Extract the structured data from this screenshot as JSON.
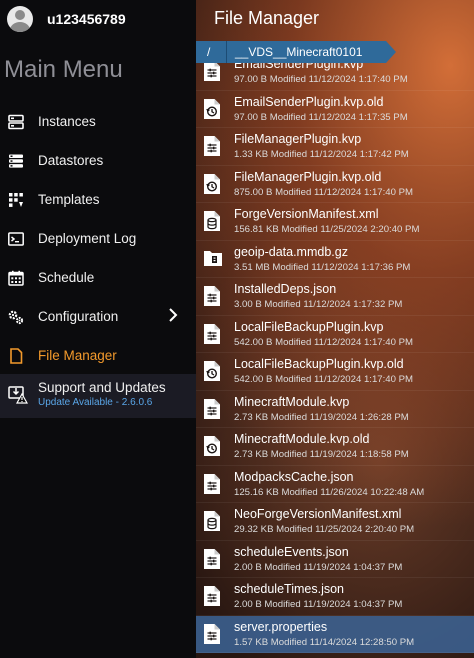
{
  "user": {
    "name": "u123456789"
  },
  "sidebar": {
    "title": "Main Menu",
    "items": [
      {
        "label": "Instances",
        "icon": "server-icon"
      },
      {
        "label": "Datastores",
        "icon": "database-icon"
      },
      {
        "label": "Templates",
        "icon": "templates-icon"
      },
      {
        "label": "Deployment Log",
        "icon": "terminal-icon"
      },
      {
        "label": "Schedule",
        "icon": "calendar-icon"
      },
      {
        "label": "Configuration",
        "icon": "gears-icon"
      },
      {
        "label": "File Manager",
        "icon": "file-icon",
        "active": true
      }
    ],
    "support": {
      "label": "Support and Updates",
      "update": "Update Available - 2.6.0.6"
    }
  },
  "main": {
    "title": "File Manager",
    "breadcrumb": {
      "root": "/",
      "folder": "__VDS__Minecraft0101"
    },
    "files": [
      {
        "name": "EmailSenderPlugin.kvp",
        "meta": "97.00 B Modified 11/12/2024 1:17:40 PM",
        "icon": "text-file-icon"
      },
      {
        "name": "EmailSenderPlugin.kvp.old",
        "meta": "97.00 B Modified 11/12/2024 1:17:35 PM",
        "icon": "history-file-icon"
      },
      {
        "name": "FileManagerPlugin.kvp",
        "meta": "1.33 KB Modified 11/12/2024 1:17:42 PM",
        "icon": "text-file-icon"
      },
      {
        "name": "FileManagerPlugin.kvp.old",
        "meta": "875.00 B Modified 11/12/2024 1:17:40 PM",
        "icon": "history-file-icon"
      },
      {
        "name": "ForgeVersionManifest.xml",
        "meta": "156.81 KB Modified 11/25/2024 2:20:40 PM",
        "icon": "data-file-icon"
      },
      {
        "name": "geoip-data.mmdb.gz",
        "meta": "3.51 MB Modified 11/12/2024 1:17:36 PM",
        "icon": "archive-file-icon"
      },
      {
        "name": "InstalledDeps.json",
        "meta": "3.00 B Modified 11/12/2024 1:17:32 PM",
        "icon": "text-file-icon"
      },
      {
        "name": "LocalFileBackupPlugin.kvp",
        "meta": "542.00 B Modified 11/12/2024 1:17:40 PM",
        "icon": "text-file-icon"
      },
      {
        "name": "LocalFileBackupPlugin.kvp.old",
        "meta": "542.00 B Modified 11/12/2024 1:17:40 PM",
        "icon": "history-file-icon"
      },
      {
        "name": "MinecraftModule.kvp",
        "meta": "2.73 KB Modified 11/19/2024 1:26:28 PM",
        "icon": "text-file-icon"
      },
      {
        "name": "MinecraftModule.kvp.old",
        "meta": "2.73 KB Modified 11/19/2024 1:18:58 PM",
        "icon": "history-file-icon"
      },
      {
        "name": "ModpacksCache.json",
        "meta": "125.16 KB Modified 11/26/2024 10:22:48 AM",
        "icon": "text-file-icon"
      },
      {
        "name": "NeoForgeVersionManifest.xml",
        "meta": "29.32 KB Modified 11/25/2024 2:20:40 PM",
        "icon": "data-file-icon"
      },
      {
        "name": "scheduleEvents.json",
        "meta": "2.00 B Modified 11/19/2024 1:04:37 PM",
        "icon": "text-file-icon"
      },
      {
        "name": "scheduleTimes.json",
        "meta": "2.00 B Modified 11/19/2024 1:04:37 PM",
        "icon": "text-file-icon"
      },
      {
        "name": "server.properties",
        "meta": "1.57 KB Modified 11/14/2024 12:28:50 PM",
        "icon": "text-file-icon",
        "selected": true
      }
    ]
  },
  "colors": {
    "accent": "#f39a2c",
    "breadcrumb": "#2f6a9a",
    "update": "#5aa6e8"
  }
}
